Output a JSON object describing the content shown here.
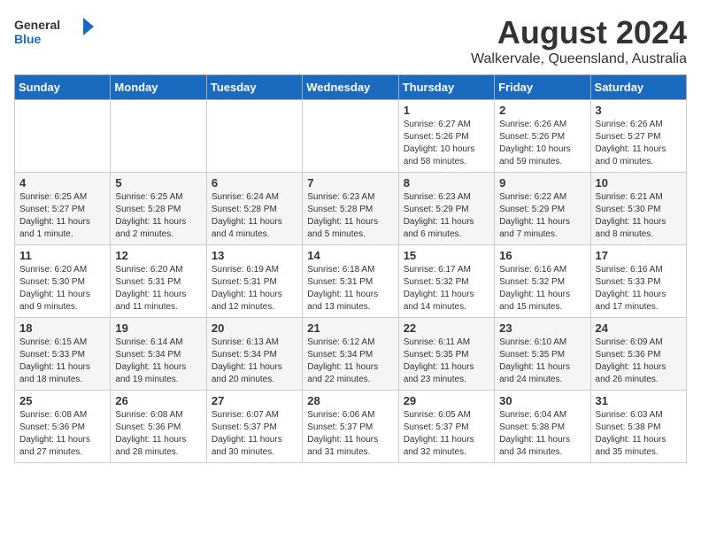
{
  "header": {
    "logo_general": "General",
    "logo_blue": "Blue",
    "main_title": "August 2024",
    "subtitle": "Walkervale, Queensland, Australia"
  },
  "days_of_week": [
    "Sunday",
    "Monday",
    "Tuesday",
    "Wednesday",
    "Thursday",
    "Friday",
    "Saturday"
  ],
  "weeks": [
    [
      {
        "day": "",
        "info": ""
      },
      {
        "day": "",
        "info": ""
      },
      {
        "day": "",
        "info": ""
      },
      {
        "day": "",
        "info": ""
      },
      {
        "day": "1",
        "info": "Sunrise: 6:27 AM\nSunset: 5:26 PM\nDaylight: 10 hours and 58 minutes."
      },
      {
        "day": "2",
        "info": "Sunrise: 6:26 AM\nSunset: 5:26 PM\nDaylight: 10 hours and 59 minutes."
      },
      {
        "day": "3",
        "info": "Sunrise: 6:26 AM\nSunset: 5:27 PM\nDaylight: 11 hours and 0 minutes."
      }
    ],
    [
      {
        "day": "4",
        "info": "Sunrise: 6:25 AM\nSunset: 5:27 PM\nDaylight: 11 hours and 1 minute."
      },
      {
        "day": "5",
        "info": "Sunrise: 6:25 AM\nSunset: 5:28 PM\nDaylight: 11 hours and 2 minutes."
      },
      {
        "day": "6",
        "info": "Sunrise: 6:24 AM\nSunset: 5:28 PM\nDaylight: 11 hours and 4 minutes."
      },
      {
        "day": "7",
        "info": "Sunrise: 6:23 AM\nSunset: 5:28 PM\nDaylight: 11 hours and 5 minutes."
      },
      {
        "day": "8",
        "info": "Sunrise: 6:23 AM\nSunset: 5:29 PM\nDaylight: 11 hours and 6 minutes."
      },
      {
        "day": "9",
        "info": "Sunrise: 6:22 AM\nSunset: 5:29 PM\nDaylight: 11 hours and 7 minutes."
      },
      {
        "day": "10",
        "info": "Sunrise: 6:21 AM\nSunset: 5:30 PM\nDaylight: 11 hours and 8 minutes."
      }
    ],
    [
      {
        "day": "11",
        "info": "Sunrise: 6:20 AM\nSunset: 5:30 PM\nDaylight: 11 hours and 9 minutes."
      },
      {
        "day": "12",
        "info": "Sunrise: 6:20 AM\nSunset: 5:31 PM\nDaylight: 11 hours and 11 minutes."
      },
      {
        "day": "13",
        "info": "Sunrise: 6:19 AM\nSunset: 5:31 PM\nDaylight: 11 hours and 12 minutes."
      },
      {
        "day": "14",
        "info": "Sunrise: 6:18 AM\nSunset: 5:31 PM\nDaylight: 11 hours and 13 minutes."
      },
      {
        "day": "15",
        "info": "Sunrise: 6:17 AM\nSunset: 5:32 PM\nDaylight: 11 hours and 14 minutes."
      },
      {
        "day": "16",
        "info": "Sunrise: 6:16 AM\nSunset: 5:32 PM\nDaylight: 11 hours and 15 minutes."
      },
      {
        "day": "17",
        "info": "Sunrise: 6:16 AM\nSunset: 5:33 PM\nDaylight: 11 hours and 17 minutes."
      }
    ],
    [
      {
        "day": "18",
        "info": "Sunrise: 6:15 AM\nSunset: 5:33 PM\nDaylight: 11 hours and 18 minutes."
      },
      {
        "day": "19",
        "info": "Sunrise: 6:14 AM\nSunset: 5:34 PM\nDaylight: 11 hours and 19 minutes."
      },
      {
        "day": "20",
        "info": "Sunrise: 6:13 AM\nSunset: 5:34 PM\nDaylight: 11 hours and 20 minutes."
      },
      {
        "day": "21",
        "info": "Sunrise: 6:12 AM\nSunset: 5:34 PM\nDaylight: 11 hours and 22 minutes."
      },
      {
        "day": "22",
        "info": "Sunrise: 6:11 AM\nSunset: 5:35 PM\nDaylight: 11 hours and 23 minutes."
      },
      {
        "day": "23",
        "info": "Sunrise: 6:10 AM\nSunset: 5:35 PM\nDaylight: 11 hours and 24 minutes."
      },
      {
        "day": "24",
        "info": "Sunrise: 6:09 AM\nSunset: 5:36 PM\nDaylight: 11 hours and 26 minutes."
      }
    ],
    [
      {
        "day": "25",
        "info": "Sunrise: 6:08 AM\nSunset: 5:36 PM\nDaylight: 11 hours and 27 minutes."
      },
      {
        "day": "26",
        "info": "Sunrise: 6:08 AM\nSunset: 5:36 PM\nDaylight: 11 hours and 28 minutes."
      },
      {
        "day": "27",
        "info": "Sunrise: 6:07 AM\nSunset: 5:37 PM\nDaylight: 11 hours and 30 minutes."
      },
      {
        "day": "28",
        "info": "Sunrise: 6:06 AM\nSunset: 5:37 PM\nDaylight: 11 hours and 31 minutes."
      },
      {
        "day": "29",
        "info": "Sunrise: 6:05 AM\nSunset: 5:37 PM\nDaylight: 11 hours and 32 minutes."
      },
      {
        "day": "30",
        "info": "Sunrise: 6:04 AM\nSunset: 5:38 PM\nDaylight: 11 hours and 34 minutes."
      },
      {
        "day": "31",
        "info": "Sunrise: 6:03 AM\nSunset: 5:38 PM\nDaylight: 11 hours and 35 minutes."
      }
    ]
  ]
}
